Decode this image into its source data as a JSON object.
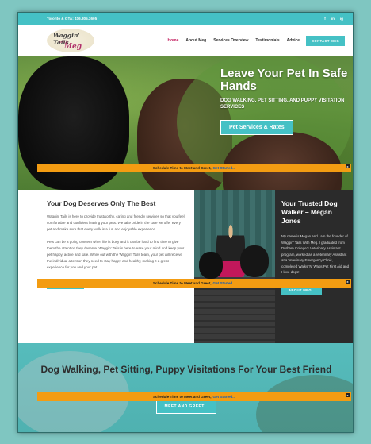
{
  "topbar": {
    "phone": "Toronto & GTA: 416.305.3605",
    "social": [
      "f",
      "in",
      "ig"
    ]
  },
  "logo": {
    "line1": "Waggin' Tails",
    "line2": "with",
    "line3": "Meg"
  },
  "nav": {
    "items": [
      {
        "label": "Home",
        "active": true
      },
      {
        "label": "About Meg",
        "active": false
      },
      {
        "label": "Services Overview",
        "active": false
      },
      {
        "label": "Testimonials",
        "active": false
      },
      {
        "label": "Advice",
        "active": false
      }
    ],
    "cta": "CONTACT MEG"
  },
  "hero": {
    "title": "Leave Your Pet In Safe Hands",
    "subtitle": "DOG WALKING, PET SITTING, AND PUPPY VISITATION SERVICES",
    "button": "Pet Services & Rates"
  },
  "banner": {
    "text": "Schedule Time to Meet and Greet,",
    "link": "Get Started...",
    "close": "x"
  },
  "section1": {
    "title": "Your Dog Deserves Only The Best",
    "para1": "Waggin' Tails is here to provide trustworthy, caring and friendly services so that you feel comfortable and confident leaving your pets. We take pride in the care we offer every pet and make sure that every walk is a fun and enjoyable experience.",
    "para2": "Pets can be a going concern when life is busy and it can be hard to find time to give them the attention they deserve. Waggin' Tails is here to ease your mind and keep your pet happy, active and safe. While out with the Waggin' Tails team, your pet will receive the individual attention they need to stay happy and healthy, making it a great experience for you and your pet.",
    "button": "SERVICES..."
  },
  "section2": {
    "title": "Your Trusted Dog Walker – Megan Jones",
    "text": "My name is Megan and I am the founder of Waggin' Tails With Meg. I graduated from Durham College's Veterinary Assistant program, worked as a Veterinary Assistant at a Veterinary Emergency Clinic, completed Walks 'N' Wags Pet First Aid and I love dogs!",
    "button": "ABOUT MEG..."
  },
  "section3": {
    "title": "Dog Walking, Pet Sitting, Puppy Visitations For Your Best Friend",
    "button": "MEET AND GREET..."
  },
  "colors": {
    "accent": "#45c1c5",
    "banner": "#f39c12",
    "active_nav": "#c2185b",
    "dark_panel": "#2b2b2b"
  }
}
